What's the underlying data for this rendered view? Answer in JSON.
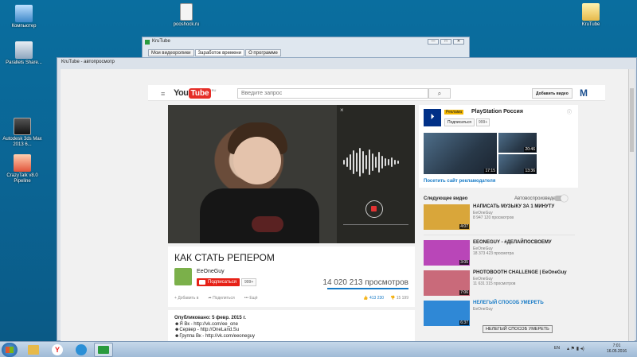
{
  "desktop": {
    "icons": [
      {
        "label": "Компьютер"
      },
      {
        "label": "Parallels Share..."
      },
      {
        "label": "Autodesk 3ds Max 2013 6..."
      },
      {
        "label": "CrazyTalk v8.0 Pipeline"
      },
      {
        "label": "pooshock.ru"
      },
      {
        "label": "KruTube"
      }
    ]
  },
  "bg_window": {
    "title": "KruTube",
    "tabs": [
      "Мои видеоролики",
      "Заработок времени",
      "О программе"
    ],
    "active_tab": "Заработок времени",
    "btn_min": "—",
    "btn_max": "□",
    "btn_close": "✕"
  },
  "main_window": {
    "title": "KruTube - автопросмотр"
  },
  "header": {
    "logo_you": "You",
    "logo_tube": "Tube",
    "logo_region": "RU",
    "search_placeholder": "Введите запрос",
    "add_video": "Добавить видео",
    "brand": "M"
  },
  "player": {
    "close_label": "×"
  },
  "video": {
    "title": "КАК СТАТЬ РЕПЕРОМ",
    "channel": "EeOneGuy",
    "subscribe": "Подписаться",
    "sub_count": "999+",
    "views": "14 020 213 просмотров",
    "actions": [
      "Добавить в",
      "Поделиться",
      "Ещё"
    ],
    "likes": "413 230",
    "dislikes": "15 199"
  },
  "description": {
    "published": "Опубликовано: 5 февр. 2015 г.",
    "lines": [
      "☻Я Вк - http://vk.com/ee_one",
      "☻Сервер - http://OneLand.Su",
      "☻Группа Вк - http://vk.com/eeoneguy"
    ]
  },
  "ad": {
    "badge": "Реклама",
    "channel": "PlayStation Россия",
    "subscribe": "Подписаться",
    "sub_count": "999+",
    "info": "ⓘ",
    "thumbs": [
      {
        "duration": "17:15"
      },
      {
        "duration": "20:46"
      },
      {
        "duration": "13:36"
      }
    ],
    "site_link": "Посетить сайт рекламодателя"
  },
  "upnext": {
    "label": "Следующее видео",
    "autoplay": "Автовоспроизведение",
    "autoplay_on": false
  },
  "related": [
    {
      "title": "НАПИСАТЬ МУЗЫКУ ЗА 1 МИНУТУ",
      "channel": "EeOneGuy",
      "views": "8 947 120 просмотров",
      "duration": "4:07",
      "color": "#d9a63a"
    },
    {
      "title": "EEONEGUY - #ДЕЛАЙПОСВОЕМУ",
      "channel": "EeOneGuy",
      "views": "18 373 423 просмотра",
      "duration": "3:05",
      "color": "#b946b8"
    },
    {
      "title": "PHOTOBOOTH CHALLENGE | EeOneGuy",
      "channel": "EeOneGuy",
      "views": "11 631 315 просмотров",
      "duration": "7:06",
      "color": "#c96a7a"
    },
    {
      "title": "НЕЛЕГЫЙ СПОСОБ УМЕРЕТЬ",
      "channel": "EeOneGuy",
      "views": "",
      "duration": "6:37",
      "color": "#2f88d6"
    }
  ],
  "tooltip": "НЕЛЕГЫЙ СПОСОБ УМЕРЕТЬ",
  "taskbar": {
    "lang": "EN",
    "time": "7:01",
    "date": "16.05.2016"
  }
}
